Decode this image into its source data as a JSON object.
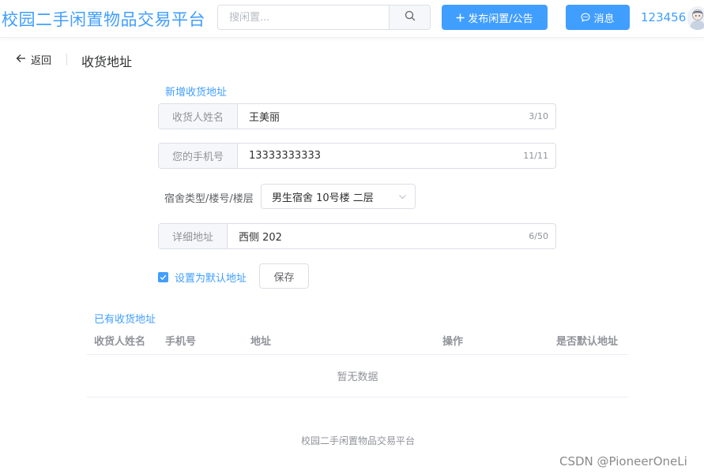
{
  "app": {
    "title": "校园二手闲置物品交易平台"
  },
  "header": {
    "search_placeholder": "搜闲置...",
    "publish_label": "发布闲置/公告",
    "message_label": "消息",
    "username": "123456"
  },
  "page": {
    "back_label": "返回",
    "title": "收货地址"
  },
  "form": {
    "section_title": "新增收货地址",
    "name": {
      "label": "收货人姓名",
      "value": "王美丽",
      "count": "3/10"
    },
    "phone": {
      "label": "您的手机号",
      "value": "13333333333",
      "count": "11/11"
    },
    "dorm": {
      "label": "宿舍类型/楼号/楼层",
      "value": "男生宿舍 10号楼 二层"
    },
    "detail": {
      "label": "详细地址",
      "value": "西侧 202",
      "count": "6/50"
    },
    "default_label": "设置为默认地址",
    "default_checked": true,
    "save_label": "保存"
  },
  "table": {
    "section_title": "已有收货地址",
    "columns": [
      "收货人姓名",
      "手机号",
      "地址",
      "操作",
      "是否默认地址"
    ],
    "rows": [],
    "empty_text": "暂无数据"
  },
  "footer": {
    "text": "校园二手闲置物品交易平台"
  },
  "watermark": "CSDN @PioneerOneLi",
  "colors": {
    "primary": "#409eff",
    "border": "#dcdfe6",
    "muted": "#909399"
  },
  "icons": [
    "search-icon",
    "plus-icon",
    "chat-icon",
    "avatar",
    "arrow-left-icon",
    "chevron-down-icon",
    "check-icon"
  ]
}
